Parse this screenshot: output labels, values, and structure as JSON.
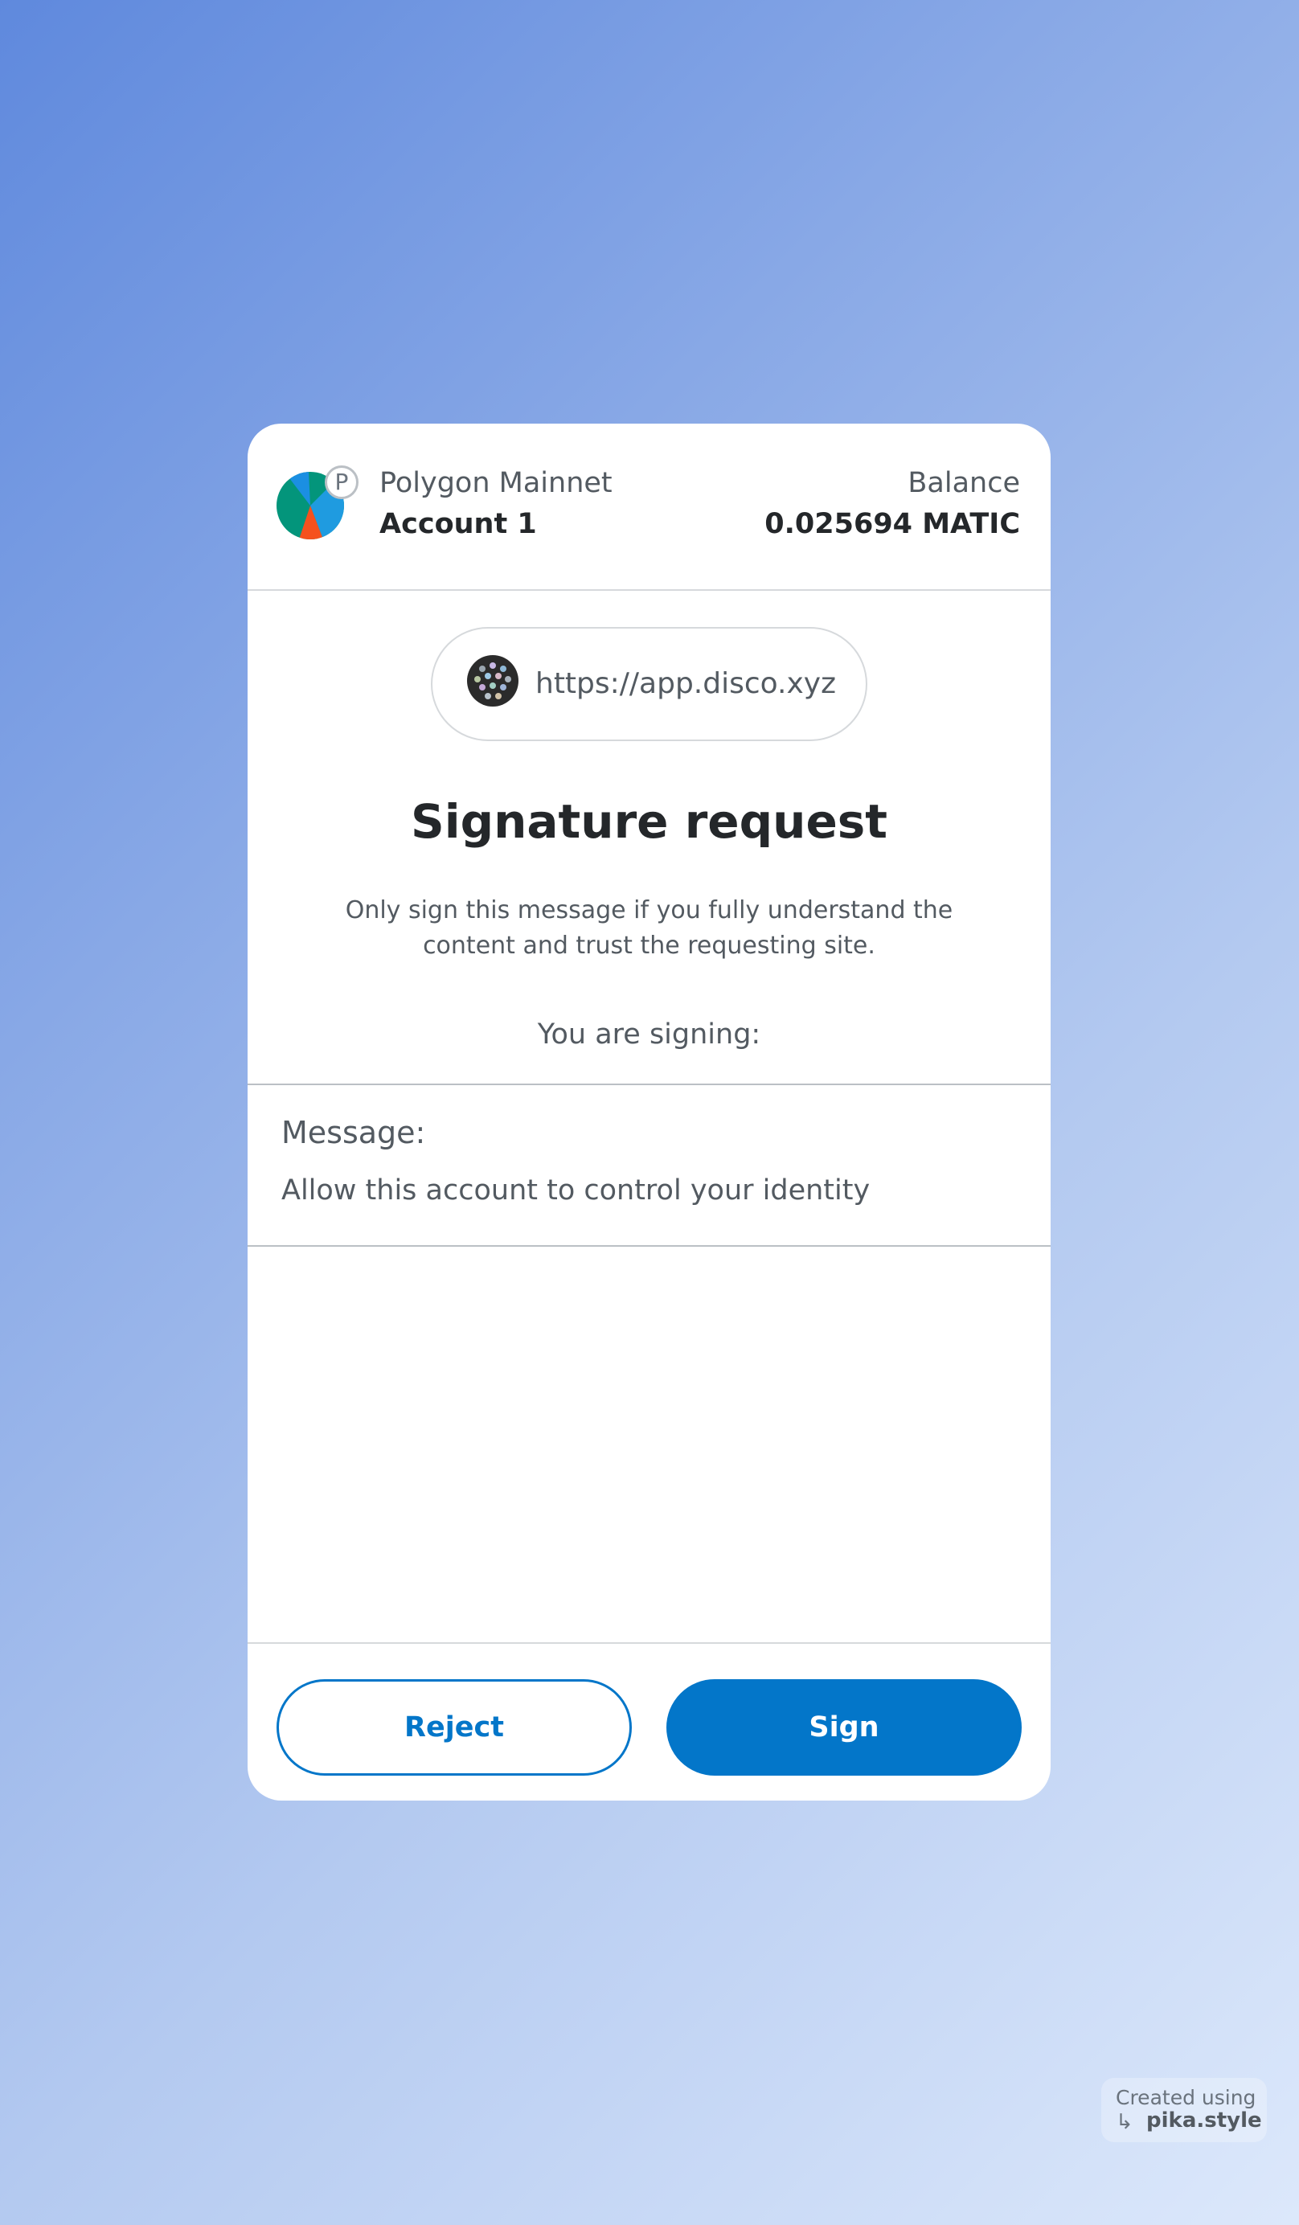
{
  "header": {
    "network_name": "Polygon Mainnet",
    "network_badge_letter": "P",
    "account_name": "Account 1",
    "balance_label": "Balance",
    "balance_value": "0.025694 MATIC"
  },
  "origin": {
    "url": "https://app.disco.xyz",
    "icon": "disco-site-icon"
  },
  "request": {
    "title": "Signature request",
    "warning": "Only sign this message if you fully understand the content and trust the requesting site.",
    "signing_label": "You are signing:"
  },
  "message": {
    "label": "Message:",
    "value": "Allow this account to control your identity"
  },
  "actions": {
    "reject_label": "Reject",
    "sign_label": "Sign"
  },
  "watermark": {
    "line1": "Created using",
    "line2": "pika.style",
    "arrow_icon": "return-arrow-icon"
  },
  "colors": {
    "primary": "#0376c9",
    "text_dark": "#24272a",
    "text_muted": "#535a61",
    "border": "#d6d9dc"
  }
}
